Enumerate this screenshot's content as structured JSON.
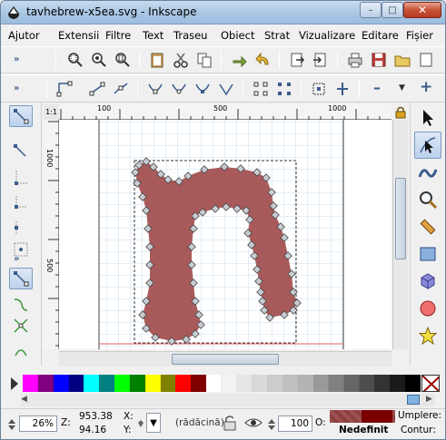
{
  "window": {
    "title": "tavhebrew-x5ea.svg - Inkscape",
    "minimize": "–",
    "maximize": "□",
    "close": "✕"
  },
  "menu": [
    "Ajutor",
    "Extensii",
    "Filtre",
    "Text",
    "Traseu",
    "Obiect",
    "Strat",
    "Vizualizare",
    "Editare",
    "Fișier"
  ],
  "toolbar": {
    "grip": "»"
  },
  "node_toolbar": {
    "grip": "»",
    "minus": "–",
    "plus": "+"
  },
  "left_toolbar": {
    "grip": "»"
  },
  "ruler": {
    "h_labels": [
      "100",
      "500",
      "1000"
    ],
    "v_labels": [
      "1000",
      "500"
    ],
    "corner": "1:1"
  },
  "palette": {
    "colors": [
      "#ff00ff",
      "#800080",
      "#0000ff",
      "#000080",
      "#00ffff",
      "#008080",
      "#00ff00",
      "#008000",
      "#ffff00",
      "#808000",
      "#ff0000",
      "#800000",
      "#ffffff",
      "#f2f2f2",
      "#e6e6e6",
      "#d9d9d9",
      "#cccccc",
      "#bfbfbf",
      "#b3b3b3",
      "#999999",
      "#808080",
      "#666666",
      "#4d4d4d",
      "#333333",
      "#1a1a1a",
      "#000000"
    ],
    "none_label": "X"
  },
  "status": {
    "zoom": "26%",
    "z_label": "Z:",
    "x_label": "X:",
    "y_label": "Y:",
    "x_value": "953.38",
    "y_value": "94.16",
    "layer": "(rădăcină)",
    "opacity_value": "100",
    "o_label": "O:",
    "fill_label": "Umplere:",
    "stroke_label": "Contur:",
    "stroke_value": "Nedefinit",
    "fill_color": "#a05050",
    "stroke_color": "#7a0000"
  },
  "shape_color": "#a85a5a",
  "accent": "#3a5c8c"
}
